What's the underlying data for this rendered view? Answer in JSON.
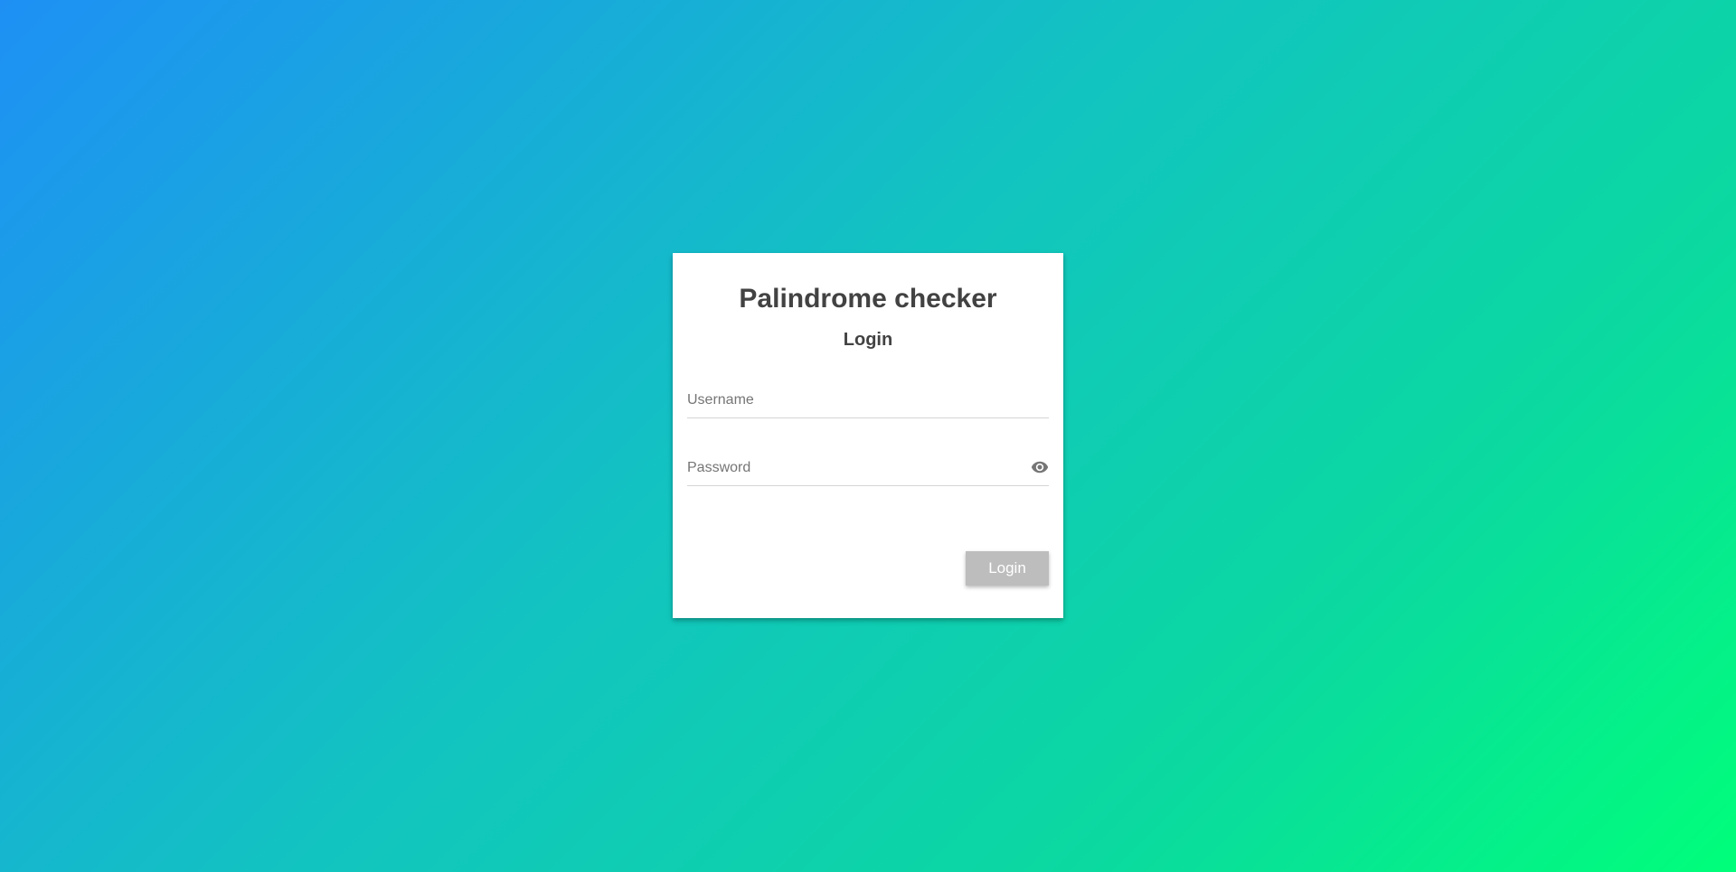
{
  "app": {
    "title": "Palindrome checker",
    "subtitle": "Login"
  },
  "form": {
    "username": {
      "value": "",
      "placeholder": "Username"
    },
    "password": {
      "value": "",
      "placeholder": "Password",
      "toggle_icon": "eye-icon"
    },
    "submit_label": "Login",
    "submit_enabled": false
  },
  "colors": {
    "background_gradient_start": "#1e90f5",
    "background_gradient_end": "#00ff7a",
    "card": "#ffffff",
    "text": "#424242",
    "button_disabled": "#bdbdbd",
    "button_text": "#ffffff"
  }
}
